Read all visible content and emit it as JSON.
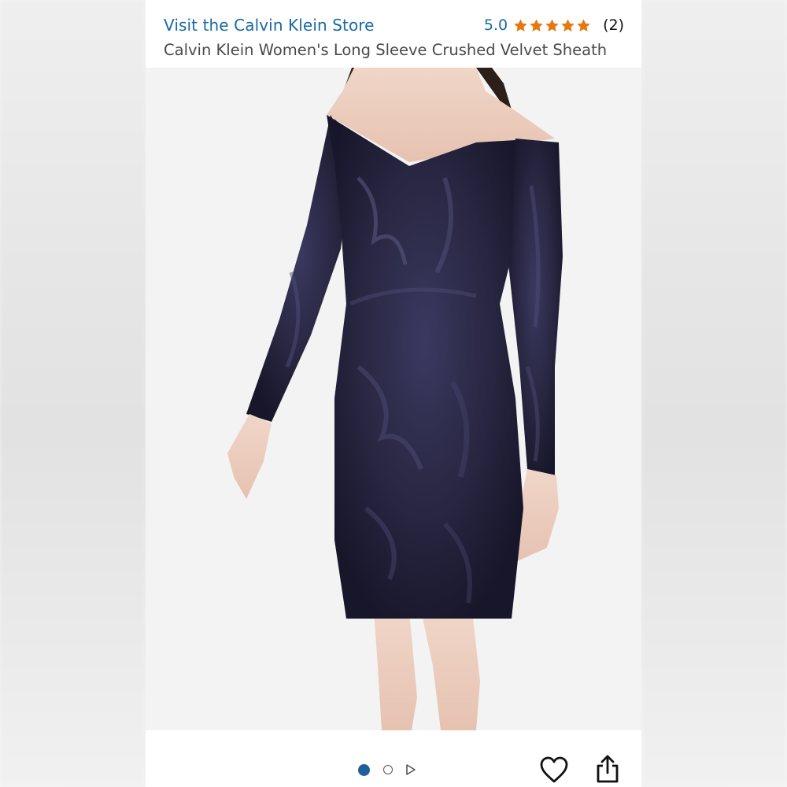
{
  "header": {
    "store_link": "Visit the Calvin Klein Store",
    "rating_value": "5.0",
    "rating_stars": 5,
    "review_count": "(2)",
    "product_title": "Calvin Klein Women's Long Sleeve Crushed Velvet Sheath"
  },
  "image_gallery": {
    "current_index": 1,
    "total_images": 2,
    "has_video": true
  },
  "colors": {
    "link_blue": "#1a6aa3",
    "star_orange": "#e47911",
    "dot_active": "#1f5f9b",
    "dress_navy": "#2a2946"
  },
  "icons": {
    "heart": "heart-icon",
    "share": "share-icon",
    "video": "play-icon",
    "star": "star-icon"
  }
}
